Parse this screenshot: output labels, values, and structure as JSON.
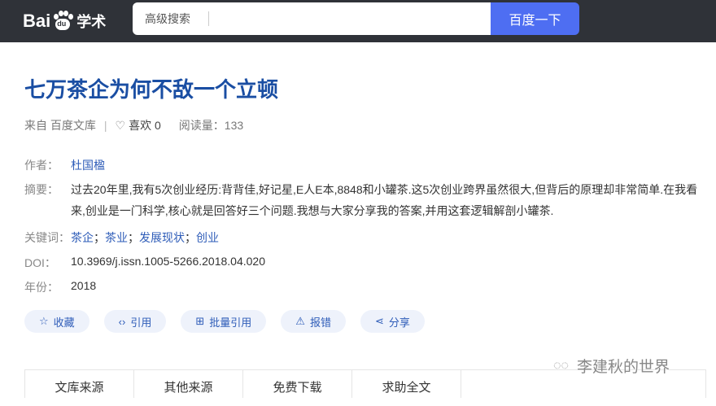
{
  "header": {
    "logo_left": "Bai",
    "logo_paw_text": "du",
    "logo_right": "学术",
    "advanced_search": "高级搜索",
    "search_value": "",
    "search_button": "百度一下"
  },
  "article": {
    "title": "七万茶企为何不敌一个立顿",
    "source": "来自 百度文库",
    "like_label": "喜欢 0",
    "reads": "阅读量：133",
    "author_label": "作者：",
    "author": "杜国楹",
    "abstract_label": "摘要：",
    "abstract": "过去20年里,我有5次创业经历:背背佳,好记星,E人E本,8848和小罐茶.这5次创业跨界虽然很大,但背后的原理却非常简单.在我看来,创业是一门科学,核心就是回答好三个问题.我想与大家分享我的答案,并用这套逻辑解剖小罐茶.",
    "keywords_label": "关键词：",
    "keywords": [
      "茶企",
      "茶业",
      "发展现状",
      "创业"
    ],
    "doi_label": "DOI：",
    "doi": "10.3969/j.issn.1005-5266.2018.04.020",
    "year_label": "年份：",
    "year": "2018"
  },
  "actions": [
    {
      "icon": "star-icon",
      "glyph": "☆",
      "label": "收藏"
    },
    {
      "icon": "code-icon",
      "glyph": "‹›",
      "label": "引用"
    },
    {
      "icon": "folder-plus-icon",
      "glyph": "⊞",
      "label": "批量引用"
    },
    {
      "icon": "warning-icon",
      "glyph": "⚠",
      "label": "报错"
    },
    {
      "icon": "share-icon",
      "glyph": "⋖",
      "label": "分享"
    }
  ],
  "tabs": [
    "文库来源",
    "其他来源",
    "免费下载",
    "求助全文"
  ],
  "watermark": "李建秋的世界",
  "colors": {
    "topbar": "#2f3238",
    "accent": "#4e6ef2",
    "title": "#1a4ea3",
    "link": "#2e5cb8"
  }
}
